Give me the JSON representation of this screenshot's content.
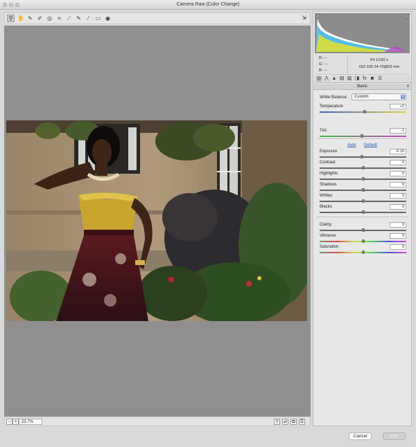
{
  "window": {
    "title": "Camera Raw (Color Change)"
  },
  "toolbar": {
    "tools": [
      {
        "name": "zoom-tool",
        "icon": "magnifier-icon",
        "glyph": "⚲",
        "active": true
      },
      {
        "name": "hand-tool",
        "icon": "hand-icon",
        "glyph": "✋"
      },
      {
        "name": "white-balance-tool",
        "icon": "eyedropper-icon",
        "glyph": "✎"
      },
      {
        "name": "color-sampler-tool",
        "icon": "sampler-icon",
        "glyph": "✐"
      },
      {
        "name": "targeted-adjustment-tool",
        "icon": "target-adjust-icon",
        "glyph": "◎"
      },
      {
        "name": "crop-tool",
        "icon": "crop-icon",
        "glyph": "⌗"
      },
      {
        "name": "straighten-tool",
        "icon": "level-icon",
        "glyph": "⟋"
      },
      {
        "name": "spot-removal-tool",
        "icon": "brush-icon",
        "glyph": "✎"
      },
      {
        "name": "adjustment-brush-tool",
        "icon": "paintbrush-icon",
        "glyph": "⁄"
      },
      {
        "name": "graduated-filter-tool",
        "icon": "filter-icon",
        "glyph": "▭"
      },
      {
        "name": "radial-filter-tool",
        "icon": "radial-icon",
        "glyph": "◉"
      }
    ],
    "right_icon": "open-preferences-icon",
    "right_glyph": "⇲"
  },
  "camera_info": {
    "r": "R:   ---",
    "g": "G:   ---",
    "b": "B:   ---",
    "exposure": "f/4    1/160 s",
    "iso_lens": "ISO 100   24-70@53 mm"
  },
  "panel_tabs": [
    "◎",
    "⋀",
    "▲",
    "▤",
    "▥",
    "◨",
    "fx",
    "◙",
    "☰"
  ],
  "section": {
    "title": "Basic",
    "menu": "≡"
  },
  "white_balance": {
    "label": "White Balance:",
    "value": "Custom"
  },
  "links": {
    "auto": "Auto",
    "default": "Default"
  },
  "sliders": {
    "temperature": {
      "label": "Temperature",
      "value": "+2",
      "level": 0.52
    },
    "tint": {
      "label": "Tint",
      "value": "-1",
      "level": 0.49
    },
    "exposure": {
      "label": "Exposure",
      "value": "-0.10",
      "level": 0.49
    },
    "contrast": {
      "label": "Contrast",
      "value": "0",
      "level": 0.5
    },
    "highlights": {
      "label": "Highlights",
      "value": "0",
      "level": 0.5
    },
    "shadows": {
      "label": "Shadows",
      "value": "0",
      "level": 0.5
    },
    "whites": {
      "label": "Whites",
      "value": "0",
      "level": 0.5
    },
    "blacks": {
      "label": "Blacks",
      "value": "0",
      "level": 0.5
    },
    "clarity": {
      "label": "Clarity",
      "value": "0",
      "level": 0.5
    },
    "vibrance": {
      "label": "Vibrance",
      "value": "0",
      "level": 0.5
    },
    "saturation": {
      "label": "Saturation",
      "value": "0",
      "level": 0.5
    }
  },
  "status": {
    "zoom": "23.7%"
  },
  "footer": {
    "cancel": "Cancel",
    "ok": "OK"
  },
  "colors": {
    "accent": "#6b8fd8",
    "histogram_bg": "#8c8c8c",
    "preview_bg": "#8f8f8f"
  }
}
